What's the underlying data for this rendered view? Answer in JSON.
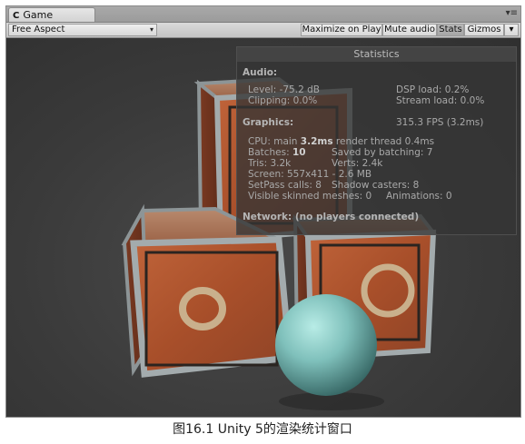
{
  "window": {
    "tab_label": "Game",
    "tab_icon_glyph": "C",
    "tab_menu_glyph": "▾≡"
  },
  "toolbar": {
    "aspect_value": "Free Aspect",
    "aspect_arrow": "▾",
    "maximize_label": "Maximize on Play",
    "mute_label": "Mute audio",
    "stats_label": "Stats",
    "gizmos_label": "Gizmos",
    "gizmos_arrow": "▾"
  },
  "stats": {
    "title": "Statistics",
    "audio_heading": "Audio:",
    "level": "Level: -75.2 dB",
    "clipping": "Clipping: 0.0%",
    "dsp_load": "DSP load: 0.2%",
    "stream_load": "Stream load: 0.0%",
    "graphics_heading": "Graphics:",
    "fps": "315.3 FPS (3.2ms)",
    "cpu_prefix": "CPU: main ",
    "cpu_main": "3.2ms",
    "cpu_suffix": "  render thread 0.4ms",
    "batches_prefix": "Batches: ",
    "batches_value": "10",
    "saved_by_batching": "Saved by batching: 7",
    "tris": "Tris: 3.2k",
    "verts": "Verts: 2.4k",
    "screen": "Screen: 557x411 - 2.6 MB",
    "setpass": "SetPass calls: 8",
    "shadow_casters": "Shadow casters: 8",
    "skinned_meshes": "Visible skinned meshes: 0",
    "animations": "Animations: 0",
    "network": "Network: (no players connected)"
  },
  "caption": "图16.1 Unity 5的渲染统计窗口",
  "colors": {
    "crate_rust": "#b0532c",
    "crate_frame": "#9aa3a6",
    "sphere": "#7fc0bb",
    "viewport_bg": "#3a3a3a",
    "panel_bg": "#343434"
  }
}
